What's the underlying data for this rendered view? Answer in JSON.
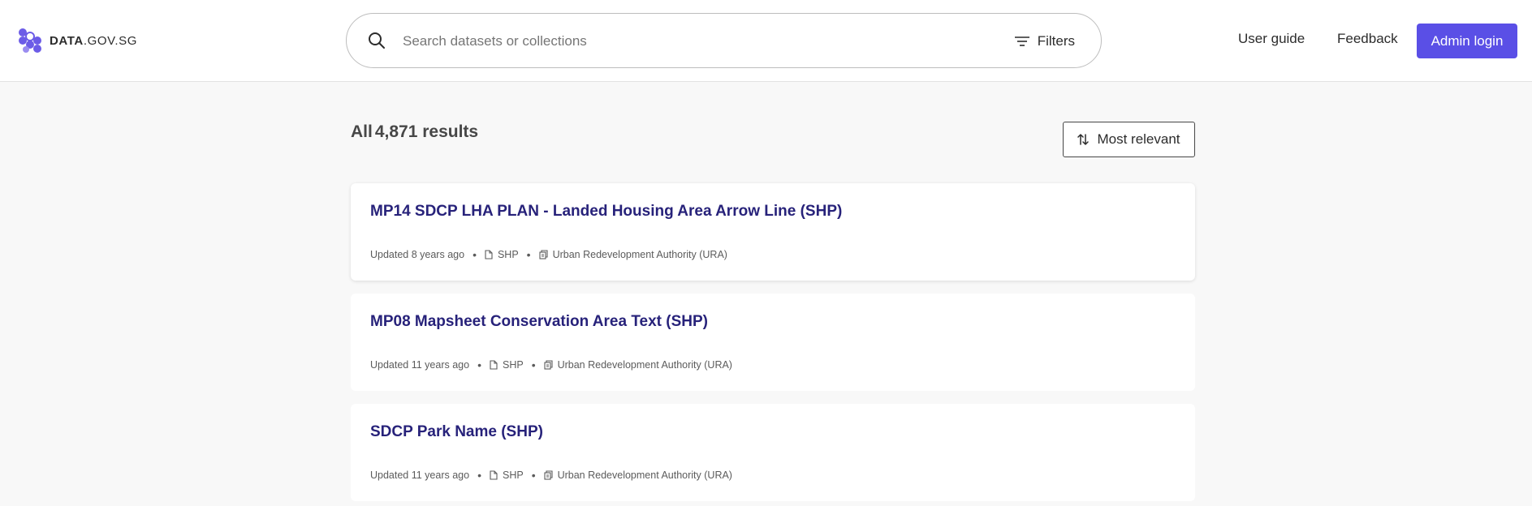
{
  "header": {
    "logo_bold": "DATA",
    "logo_rest": ".GOV.SG",
    "search_placeholder": "Search datasets or collections",
    "filters_label": "Filters",
    "nav": [
      "User guide",
      "Feedback"
    ],
    "admin_label": "Admin login"
  },
  "results": {
    "prefix": "All",
    "count": "4,871 results",
    "sort_label": "Most relevant"
  },
  "datasets": [
    {
      "title": "MP14 SDCP LHA PLAN - Landed Housing Area Arrow Line (SHP)",
      "updated": "Updated 8 years ago",
      "format": "SHP",
      "agency": "Urban Redevelopment Authority (URA)"
    },
    {
      "title": "MP08 Mapsheet Conservation Area Text (SHP)",
      "updated": "Updated 11 years ago",
      "format": "SHP",
      "agency": "Urban Redevelopment Authority (URA)"
    },
    {
      "title": "SDCP Park Name (SHP)",
      "updated": "Updated 11 years ago",
      "format": "SHP",
      "agency": "Urban Redevelopment Authority (URA)"
    }
  ],
  "colors": {
    "brand": "#5a4fe6",
    "title_link": "#27227a"
  },
  "icons": [
    "logo-hexagons-icon",
    "search-icon",
    "filter-icon",
    "sort-arrows-icon",
    "file-icon",
    "agency-icon"
  ]
}
